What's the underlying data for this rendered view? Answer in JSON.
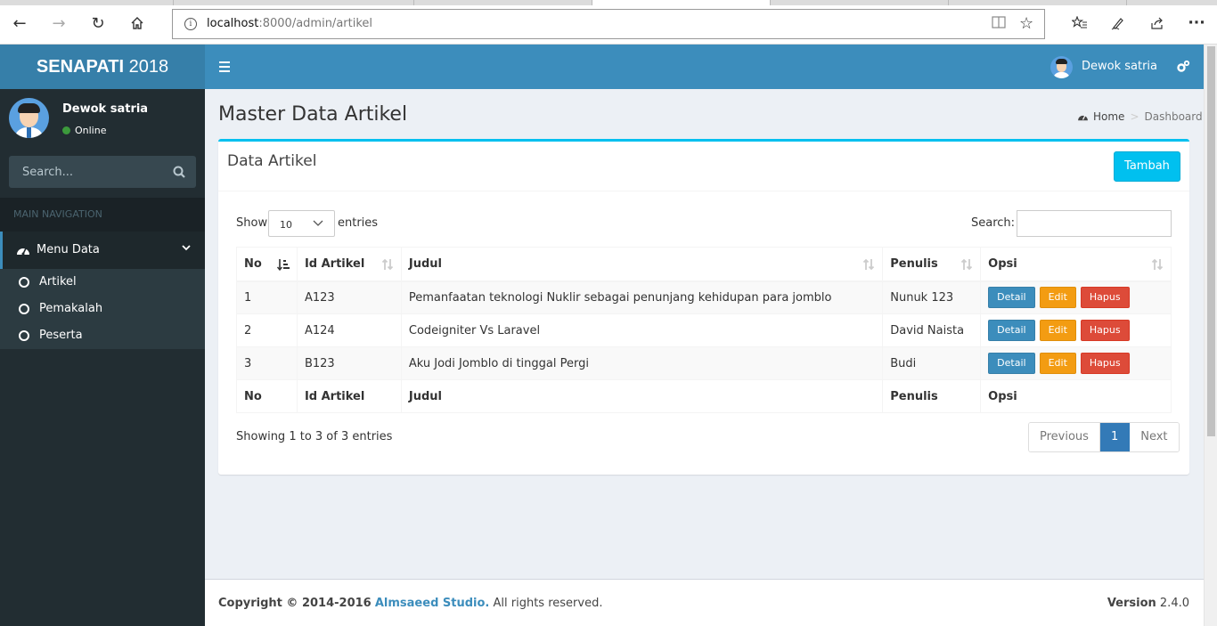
{
  "browser": {
    "url_host": "localhost",
    "url_path": ":8000/admin/artikel"
  },
  "sidebar": {
    "logo_bold": "SENAPATI",
    "logo_rest": " 2018",
    "user_name": "Dewok satria",
    "user_status": "Online",
    "search_placeholder": "Search...",
    "nav_header": "MAIN NAVIGATION",
    "menu_label": "Menu Data",
    "items": [
      {
        "label": "Artikel"
      },
      {
        "label": "Pemakalah"
      },
      {
        "label": "Peserta"
      }
    ]
  },
  "header": {
    "user_name": "Dewok satria"
  },
  "content": {
    "page_title": "Master Data Artikel",
    "breadcrumb": {
      "home": "Home",
      "current": "Dashboard"
    },
    "box_title": "Data Artikel",
    "add_button": "Tambah",
    "show_label": "Show",
    "entries_value": "10",
    "entries_label": "entries",
    "search_label": "Search:",
    "columns": [
      "No",
      "Id Artikel",
      "Judul",
      "Penulis",
      "Opsi"
    ],
    "rows": [
      {
        "no": "1",
        "id": "A123",
        "judul": "Pemanfaatan teknologi Nuklir sebagai penunjang kehidupan para jomblo",
        "penulis": "Nunuk 123"
      },
      {
        "no": "2",
        "id": "A124",
        "judul": "Codeigniter Vs Laravel",
        "penulis": "David Naista"
      },
      {
        "no": "3",
        "id": "B123",
        "judul": "Aku Jodi Jomblo di tinggal Pergi",
        "penulis": "Budi"
      }
    ],
    "actions": {
      "detail": "Detail",
      "edit": "Edit",
      "hapus": "Hapus"
    },
    "info": "Showing 1 to 3 of 3 entries",
    "pagination": {
      "previous": "Previous",
      "page": "1",
      "next": "Next"
    }
  },
  "footer": {
    "copyright": "Copyright © 2014-2016",
    "company": "Almsaeed Studio.",
    "rights": " All rights reserved.",
    "version_label": "Version",
    "version_value": " 2.4.0"
  },
  "colors": {
    "header": "#3c8dbc",
    "logo": "#367fa9",
    "sidebar": "#222d32",
    "accent": "#00c0ef",
    "edit": "#f39c12",
    "delete": "#dd4b39"
  }
}
